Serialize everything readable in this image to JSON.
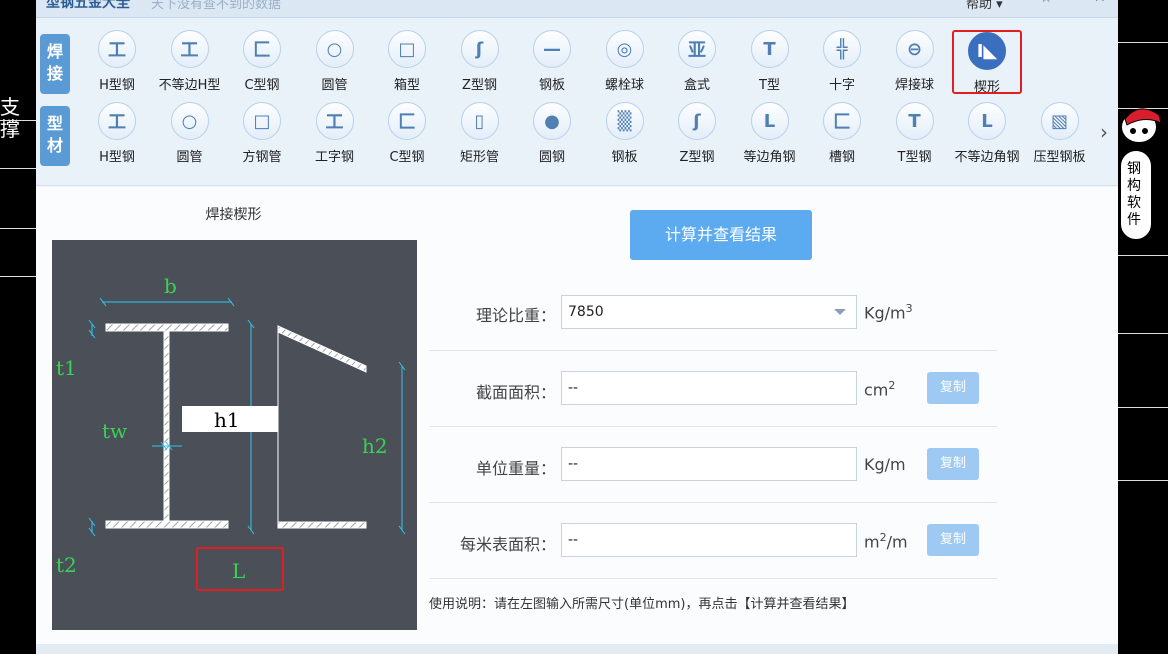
{
  "window": {
    "title": "型钢五金大全",
    "subtitle": "天下没有查不到的数据",
    "help_label": "帮助",
    "help_chevron": "chevron-down-icon",
    "pin_icon": "pin-icon",
    "minimize_icon": "minimize-icon",
    "close_icon": "close-icon"
  },
  "categories": {
    "welding": "焊接",
    "profile": "型材"
  },
  "welding_items": [
    {
      "label": "H型钢",
      "glyph": "工",
      "icon": "h-beam-icon"
    },
    {
      "label": "不等边H型",
      "glyph": "工",
      "icon": "unequal-h-icon"
    },
    {
      "label": "C型钢",
      "glyph": "匚",
      "icon": "c-channel-icon"
    },
    {
      "label": "圆管",
      "glyph": "○",
      "icon": "round-pipe-icon"
    },
    {
      "label": "箱型",
      "glyph": "□",
      "icon": "box-section-icon"
    },
    {
      "label": "Z型钢",
      "glyph": "ʃ",
      "icon": "z-section-icon"
    },
    {
      "label": "钢板",
      "glyph": "—",
      "icon": "steel-plate-icon"
    },
    {
      "label": "螺栓球",
      "glyph": "◎",
      "icon": "bolt-ball-icon"
    },
    {
      "label": "盒式",
      "glyph": "亚",
      "icon": "box-type-icon"
    },
    {
      "label": "T型",
      "glyph": "T",
      "icon": "t-section-icon"
    },
    {
      "label": "十字",
      "glyph": "╬",
      "icon": "cross-section-icon"
    },
    {
      "label": "焊接球",
      "glyph": "⊖",
      "icon": "welded-ball-icon"
    },
    {
      "label": "楔形",
      "glyph": "I◣",
      "icon": "wedge-icon"
    }
  ],
  "profile_items": [
    {
      "label": "H型钢",
      "glyph": "工",
      "icon": "h-beam-icon"
    },
    {
      "label": "圆管",
      "glyph": "○",
      "icon": "round-pipe-icon"
    },
    {
      "label": "方钢管",
      "glyph": "□",
      "icon": "square-tube-icon"
    },
    {
      "label": "工字钢",
      "glyph": "工",
      "icon": "i-beam-icon"
    },
    {
      "label": "C型钢",
      "glyph": "匚",
      "icon": "c-channel-icon"
    },
    {
      "label": "矩形管",
      "glyph": "▯",
      "icon": "rect-tube-icon"
    },
    {
      "label": "圆钢",
      "glyph": "●",
      "icon": "round-bar-icon"
    },
    {
      "label": "钢板",
      "glyph": "▒",
      "icon": "steel-plate-icon"
    },
    {
      "label": "Z型钢",
      "glyph": "ʃ",
      "icon": "z-section-icon"
    },
    {
      "label": "等边角钢",
      "glyph": "L",
      "icon": "equal-angle-icon"
    },
    {
      "label": "槽钢",
      "glyph": "匚",
      "icon": "channel-icon"
    },
    {
      "label": "T型钢",
      "glyph": "T",
      "icon": "t-section-icon"
    },
    {
      "label": "不等边角钢",
      "glyph": "L",
      "icon": "unequal-angle-icon"
    },
    {
      "label": "压型钢板",
      "glyph": "▧",
      "icon": "profiled-sheet-icon"
    }
  ],
  "selected_item": "楔形",
  "next_arrow": "chevron-right-icon",
  "diagram": {
    "title": "焊接楔形",
    "labels": {
      "b": "b",
      "t1": "t1",
      "tw": "tw",
      "h1": "h1",
      "h2": "h2",
      "t2": "t2",
      "L": "L"
    }
  },
  "calc_button": "计算并查看结果",
  "form": {
    "density": {
      "label": "理论比重：",
      "value": "7850",
      "unit_base": "Kg/m",
      "unit_sup": "3"
    },
    "area": {
      "label": "截面面积：",
      "value": "--",
      "unit_base": "cm",
      "unit_sup": "2",
      "copy": "复制"
    },
    "weight": {
      "label": "单位重量：",
      "value": "--",
      "unit": "Kg/m",
      "copy": "复制"
    },
    "surface": {
      "label": "每米表面积：",
      "value": "--",
      "unit_base": "m",
      "unit_sup": "2",
      "unit_tail": "/m",
      "copy": "复制"
    }
  },
  "usage_note": "使用说明：请在左图输入所需尺寸(单位mm)，再点击【计算并查看结果】",
  "cad_text": "支撑",
  "mascot_text": "钢构软件",
  "colors": {
    "accent": "#5cabf0",
    "selected": "#3a6fbf",
    "highlight": "#e02020",
    "diagram_bg": "#4b5058",
    "dim_green": "#39d353",
    "dim_cyan": "#2ec5ef"
  }
}
